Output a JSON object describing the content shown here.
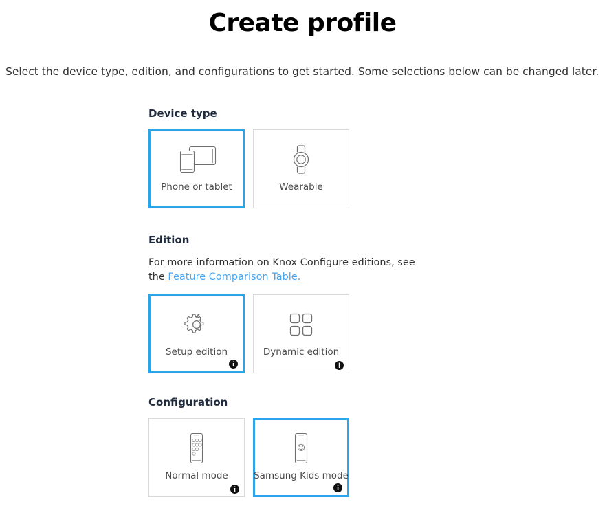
{
  "page": {
    "title": "Create profile",
    "subtitle": "Select the device type, edition, and configurations to get started. Some selections below can be changed later."
  },
  "colors": {
    "accent": "#2ba4ea",
    "link": "#4ba6ef",
    "card_border": "#d9d9d9",
    "heading": "#1f2b3d",
    "label": "#4a4a4a"
  },
  "sections": [
    {
      "id": "device-type",
      "heading": "Device type",
      "description": null,
      "options": [
        {
          "id": "phone-or-tablet",
          "label": "Phone or tablet",
          "icon": "phone-tablet-icon",
          "selected": true,
          "has_info": false
        },
        {
          "id": "wearable",
          "label": "Wearable",
          "icon": "wearable-watch-icon",
          "selected": false,
          "has_info": false
        }
      ]
    },
    {
      "id": "edition",
      "heading": "Edition",
      "description": {
        "before": "For more information on Knox Configure editions, see the ",
        "link": "Feature Comparison Table.",
        "after": ""
      },
      "options": [
        {
          "id": "setup-edition",
          "label": "Setup edition",
          "icon": "gear-icon",
          "selected": true,
          "has_info": true
        },
        {
          "id": "dynamic-edition",
          "label": "Dynamic edition",
          "icon": "grid-squares-icon",
          "selected": false,
          "has_info": true
        }
      ]
    },
    {
      "id": "configuration",
      "heading": "Configuration",
      "description": null,
      "options": [
        {
          "id": "normal-mode",
          "label": "Normal mode",
          "icon": "phone-apps-icon",
          "selected": false,
          "has_info": true
        },
        {
          "id": "samsung-kids-mode",
          "label": "Samsung Kids mode",
          "icon": "phone-kids-icon",
          "selected": true,
          "has_info": true
        }
      ]
    }
  ],
  "info_badge": {
    "label": "i",
    "name": "info-icon"
  }
}
